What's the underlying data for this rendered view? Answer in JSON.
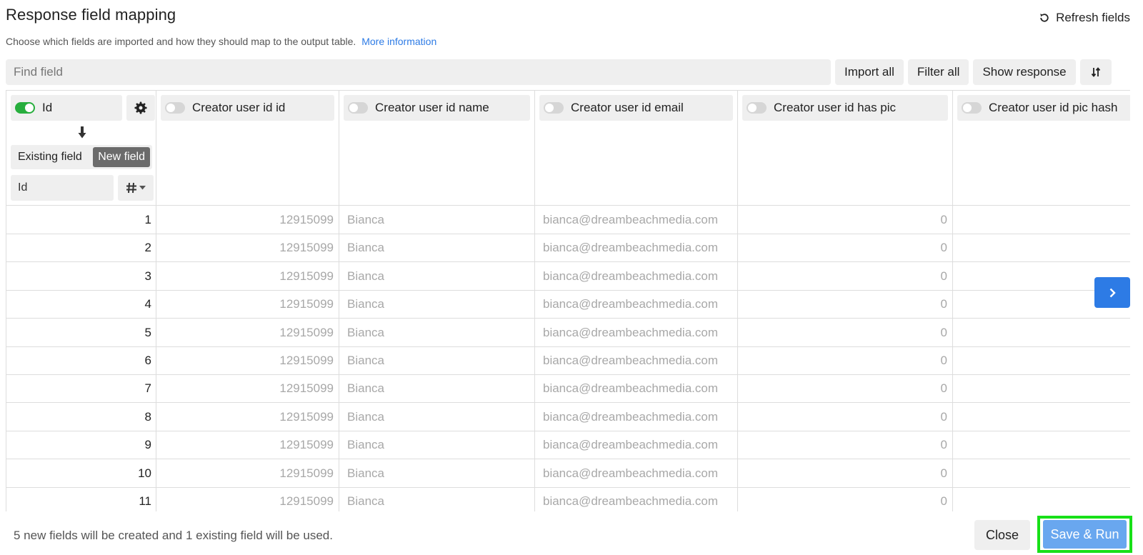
{
  "header": {
    "title": "Response field mapping",
    "refresh_label": "Refresh fields",
    "subtitle": "Choose which fields are imported and how they should map to the output table.",
    "more_info_link": "More information"
  },
  "toolbar": {
    "search_placeholder": "Find field",
    "import_all": "Import all",
    "filter_all": "Filter all",
    "show_response": "Show response"
  },
  "id_column": {
    "label": "Id",
    "enabled": true,
    "existing_field": "Existing field",
    "new_field": "New field",
    "name_value": "Id"
  },
  "columns": [
    {
      "label": "Creator user id id",
      "enabled": false
    },
    {
      "label": "Creator user id name",
      "enabled": false
    },
    {
      "label": "Creator user id email",
      "enabled": false
    },
    {
      "label": "Creator user id has pic",
      "enabled": false
    },
    {
      "label": "Creator user id pic hash",
      "enabled": false
    }
  ],
  "rows": [
    {
      "id": "1",
      "c1": "12915099",
      "c2": "Bianca",
      "c3": "bianca@dreambeachmedia.com",
      "c4": "0",
      "c5": ""
    },
    {
      "id": "2",
      "c1": "12915099",
      "c2": "Bianca",
      "c3": "bianca@dreambeachmedia.com",
      "c4": "0",
      "c5": ""
    },
    {
      "id": "3",
      "c1": "12915099",
      "c2": "Bianca",
      "c3": "bianca@dreambeachmedia.com",
      "c4": "0",
      "c5": ""
    },
    {
      "id": "4",
      "c1": "12915099",
      "c2": "Bianca",
      "c3": "bianca@dreambeachmedia.com",
      "c4": "0",
      "c5": ""
    },
    {
      "id": "5",
      "c1": "12915099",
      "c2": "Bianca",
      "c3": "bianca@dreambeachmedia.com",
      "c4": "0",
      "c5": ""
    },
    {
      "id": "6",
      "c1": "12915099",
      "c2": "Bianca",
      "c3": "bianca@dreambeachmedia.com",
      "c4": "0",
      "c5": ""
    },
    {
      "id": "7",
      "c1": "12915099",
      "c2": "Bianca",
      "c3": "bianca@dreambeachmedia.com",
      "c4": "0",
      "c5": ""
    },
    {
      "id": "8",
      "c1": "12915099",
      "c2": "Bianca",
      "c3": "bianca@dreambeachmedia.com",
      "c4": "0",
      "c5": ""
    },
    {
      "id": "9",
      "c1": "12915099",
      "c2": "Bianca",
      "c3": "bianca@dreambeachmedia.com",
      "c4": "0",
      "c5": ""
    },
    {
      "id": "10",
      "c1": "12915099",
      "c2": "Bianca",
      "c3": "bianca@dreambeachmedia.com",
      "c4": "0",
      "c5": ""
    },
    {
      "id": "11",
      "c1": "12915099",
      "c2": "Bianca",
      "c3": "bianca@dreambeachmedia.com",
      "c4": "0",
      "c5": ""
    }
  ],
  "footer": {
    "summary": "5 new fields will be created and 1 existing field will be used.",
    "close_label": "Close",
    "save_run_label": "Save & Run"
  },
  "icons": {
    "refresh": "refresh-icon",
    "sort": "sort-icon",
    "gear": "gear-icon",
    "arrow_down": "arrow-down-icon",
    "hash": "hash-icon",
    "chevron_right": "chevron-right-icon"
  },
  "colors": {
    "accent": "#2d7be5",
    "toggle_on": "#27ae3d",
    "save_button": "#69a7ef",
    "highlight_border": "#18e018"
  }
}
